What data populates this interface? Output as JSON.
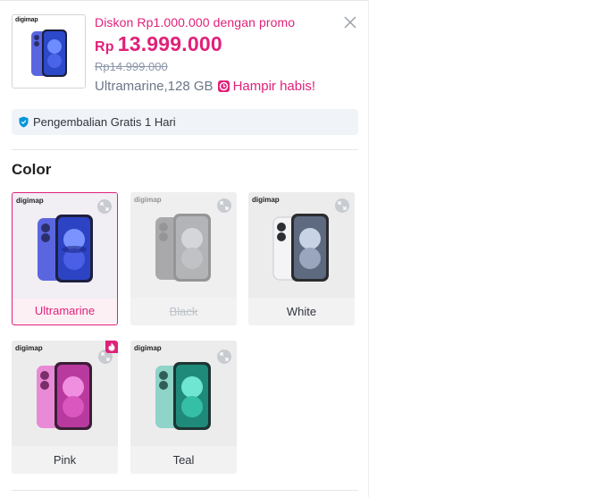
{
  "product": {
    "thumb_brand": "digimap",
    "promo": "Diskon Rp1.000.000 dengan promo",
    "currency": "Rp",
    "price": "13.999.000",
    "old_price": "Rp14.999.000",
    "variant": "Ultramarine,128 GB",
    "stock_alert": "Hampir habis!"
  },
  "return_policy": "Pengembalian Gratis 1 Hari",
  "color_section": {
    "title": "Color",
    "options": [
      {
        "label": "Ultramarine",
        "brand": "digimap",
        "state": "selected",
        "color": "#4f5ad9"
      },
      {
        "label": "Black",
        "brand": "digimap",
        "state": "disabled",
        "color": "#3b3c40"
      },
      {
        "label": "White",
        "brand": "digimap",
        "state": "normal",
        "color": "#e8e9ec"
      },
      {
        "label": "Pink",
        "brand": "digimap",
        "state": "normal",
        "color": "#e36cc8",
        "badge": "fire-icon"
      },
      {
        "label": "Teal",
        "brand": "digimap",
        "state": "normal",
        "color": "#7ecbc2"
      }
    ]
  },
  "colors": {
    "accent": "#e0217a",
    "muted": "#8d96aa",
    "shield": "#0095da"
  }
}
